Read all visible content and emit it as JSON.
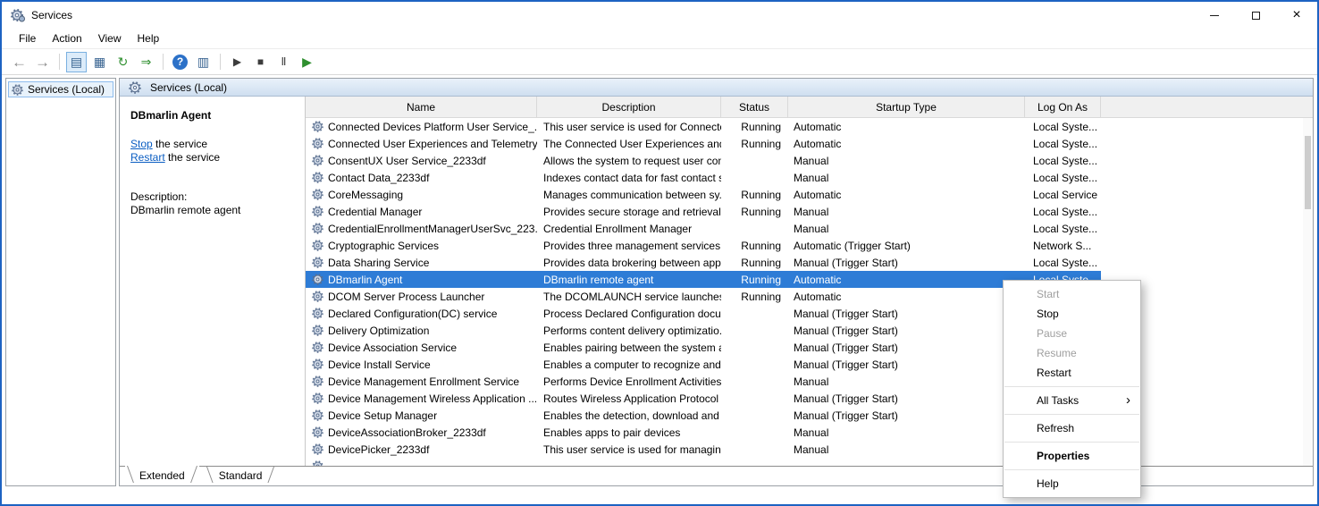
{
  "colors": {
    "selection_bg": "#2e7cd6",
    "link": "#0a5dc2",
    "window_border": "#1d63c2",
    "menu_disabled": "#9f9f9f"
  },
  "window": {
    "title": "Services",
    "controls": [
      {
        "name": "minimize-button",
        "icon": "minimize-icon"
      },
      {
        "name": "maximize-button",
        "icon": "maximize-icon"
      },
      {
        "name": "close-button",
        "icon": "close-icon",
        "glyph": "×"
      }
    ]
  },
  "menu_bar": {
    "items": [
      "File",
      "Action",
      "View",
      "Help"
    ]
  },
  "toolbar": {
    "icons": [
      {
        "name": "back-icon",
        "glyph": "←",
        "cls": "nav"
      },
      {
        "name": "forward-icon",
        "glyph": "→",
        "cls": "nav"
      },
      {
        "type": "separator"
      },
      {
        "name": "show-console-tree-icon",
        "glyph": "▤",
        "cls": "blue boxed"
      },
      {
        "name": "properties-icon",
        "glyph": "▦",
        "cls": "blue"
      },
      {
        "name": "refresh-icon",
        "glyph": "↻",
        "cls": "green"
      },
      {
        "name": "export-list-icon",
        "glyph": "⇒",
        "cls": "green"
      },
      {
        "type": "separator"
      },
      {
        "name": "help-icon",
        "glyph": "?",
        "cls": "help-badge"
      },
      {
        "name": "show-action-pane-icon",
        "glyph": "▥",
        "cls": "blue"
      },
      {
        "type": "separator"
      },
      {
        "name": "start-service-icon",
        "glyph": "▶",
        "cls": "dark"
      },
      {
        "name": "stop-service-icon",
        "glyph": "■",
        "cls": "dark"
      },
      {
        "name": "pause-service-icon",
        "glyph": "Ⅱ",
        "cls": "dark"
      },
      {
        "name": "restart-service-icon",
        "glyph": "▶",
        "cls": "green"
      }
    ]
  },
  "tree": {
    "root_label": "Services (Local)"
  },
  "panel_header": {
    "title": "Services (Local)"
  },
  "detail_pane": {
    "service_name": "DBmarlin Agent",
    "links": [
      {
        "action": "Stop",
        "suffix": " the service"
      },
      {
        "action": "Restart",
        "suffix": " the service"
      }
    ],
    "description_label": "Description:",
    "description_text": "DBmarlin remote agent"
  },
  "table": {
    "columns": [
      "Name",
      "Description",
      "Status",
      "Startup Type",
      "Log On As"
    ],
    "rows": [
      {
        "name": "Connected Devices Platform User Service_...",
        "description": "This user service is used for Connecte...",
        "status": "Running",
        "startup_type": "Automatic",
        "log_on_as": "Local Syste..."
      },
      {
        "name": "Connected User Experiences and Telemetry",
        "description": "The Connected User Experiences and ...",
        "status": "Running",
        "startup_type": "Automatic",
        "log_on_as": "Local Syste..."
      },
      {
        "name": "ConsentUX User Service_2233df",
        "description": "Allows the system to request user con...",
        "status": "",
        "startup_type": "Manual",
        "log_on_as": "Local Syste..."
      },
      {
        "name": "Contact Data_2233df",
        "description": "Indexes contact data for fast contact s...",
        "status": "",
        "startup_type": "Manual",
        "log_on_as": "Local Syste..."
      },
      {
        "name": "CoreMessaging",
        "description": "Manages communication between sy...",
        "status": "Running",
        "startup_type": "Automatic",
        "log_on_as": "Local Service"
      },
      {
        "name": "Credential Manager",
        "description": "Provides secure storage and retrieval ...",
        "status": "Running",
        "startup_type": "Manual",
        "log_on_as": "Local Syste..."
      },
      {
        "name": "CredentialEnrollmentManagerUserSvc_223...",
        "description": "Credential Enrollment Manager",
        "status": "",
        "startup_type": "Manual",
        "log_on_as": "Local Syste..."
      },
      {
        "name": "Cryptographic Services",
        "description": "Provides three management services: ...",
        "status": "Running",
        "startup_type": "Automatic (Trigger Start)",
        "log_on_as": "Network S..."
      },
      {
        "name": "Data Sharing Service",
        "description": "Provides data brokering between appl...",
        "status": "Running",
        "startup_type": "Manual (Trigger Start)",
        "log_on_as": "Local Syste..."
      },
      {
        "name": "DBmarlin Agent",
        "description": "DBmarlin remote agent",
        "status": "Running",
        "startup_type": "Automatic",
        "log_on_as": "Local Syste...",
        "selected": true
      },
      {
        "name": "DCOM Server Process Launcher",
        "description": "The DCOMLAUNCH service launches ...",
        "status": "Running",
        "startup_type": "Automatic",
        "log_on_as": ""
      },
      {
        "name": "Declared Configuration(DC) service",
        "description": "Process Declared Configuration docu...",
        "status": "",
        "startup_type": "Manual (Trigger Start)",
        "log_on_as": ""
      },
      {
        "name": "Delivery Optimization",
        "description": "Performs content delivery optimizatio...",
        "status": "",
        "startup_type": "Manual (Trigger Start)",
        "log_on_as": ""
      },
      {
        "name": "Device Association Service",
        "description": "Enables pairing between the system a...",
        "status": "",
        "startup_type": "Manual (Trigger Start)",
        "log_on_as": ""
      },
      {
        "name": "Device Install Service",
        "description": "Enables a computer to recognize and ...",
        "status": "",
        "startup_type": "Manual (Trigger Start)",
        "log_on_as": ""
      },
      {
        "name": "Device Management Enrollment Service",
        "description": "Performs Device Enrollment Activities...",
        "status": "",
        "startup_type": "Manual",
        "log_on_as": ""
      },
      {
        "name": "Device Management Wireless Application ...",
        "description": "Routes Wireless Application Protocol ...",
        "status": "",
        "startup_type": "Manual (Trigger Start)",
        "log_on_as": ""
      },
      {
        "name": "Device Setup Manager",
        "description": "Enables the detection, download and ...",
        "status": "",
        "startup_type": "Manual (Trigger Start)",
        "log_on_as": ""
      },
      {
        "name": "DeviceAssociationBroker_2233df",
        "description": "Enables apps to pair devices",
        "status": "",
        "startup_type": "Manual",
        "log_on_as": ""
      },
      {
        "name": "DevicePicker_2233df",
        "description": "This user service is used for managing...",
        "status": "",
        "startup_type": "Manual",
        "log_on_as": ""
      }
    ]
  },
  "tabs": [
    {
      "label": "Extended",
      "active": true
    },
    {
      "label": "Standard",
      "active": false
    }
  ],
  "context_menu": {
    "submenu_arrow": "›",
    "items": [
      {
        "label": "Start",
        "state": "disabled"
      },
      {
        "label": "Stop"
      },
      {
        "label": "Pause",
        "state": "disabled"
      },
      {
        "label": "Resume",
        "state": "disabled"
      },
      {
        "label": "Restart"
      },
      {
        "type": "separator"
      },
      {
        "label": "All Tasks",
        "submenu": true
      },
      {
        "type": "separator"
      },
      {
        "label": "Refresh"
      },
      {
        "type": "separator"
      },
      {
        "label": "Properties",
        "default": true
      },
      {
        "type": "separator"
      },
      {
        "label": "Help"
      }
    ]
  }
}
